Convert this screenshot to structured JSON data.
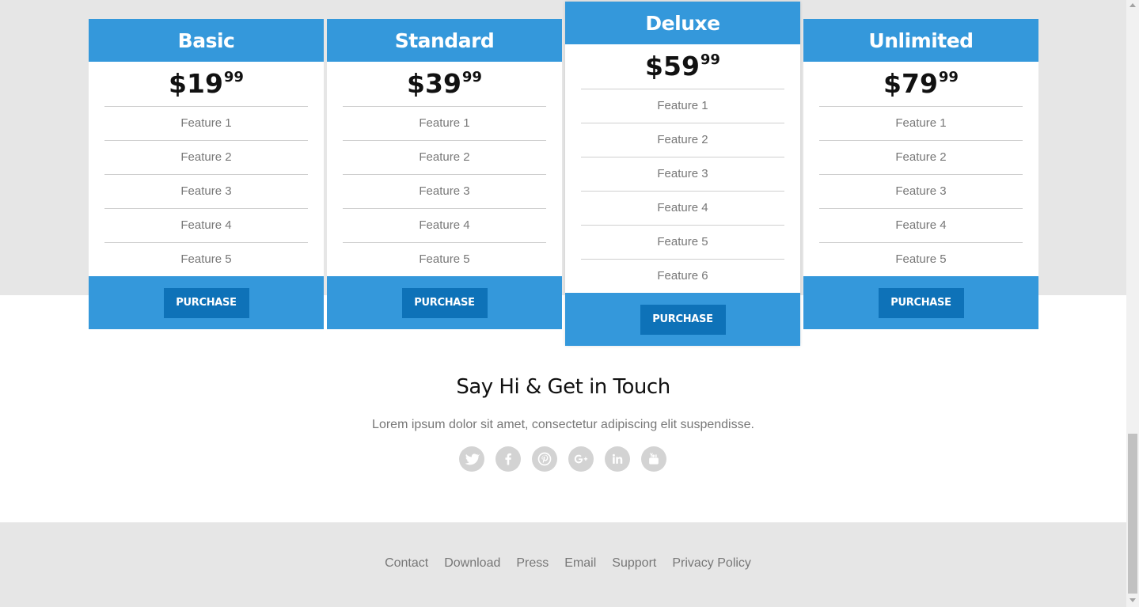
{
  "plans": [
    {
      "name": "Basic",
      "price_main": "$19",
      "price_cents": "99",
      "features": [
        "Feature 1",
        "Feature 2",
        "Feature 3",
        "Feature 4",
        "Feature 5"
      ],
      "button": "PURCHASE"
    },
    {
      "name": "Standard",
      "price_main": "$39",
      "price_cents": "99",
      "features": [
        "Feature 1",
        "Feature 2",
        "Feature 3",
        "Feature 4",
        "Feature 5"
      ],
      "button": "PURCHASE"
    },
    {
      "name": "Deluxe",
      "price_main": "$59",
      "price_cents": "99",
      "features": [
        "Feature 1",
        "Feature 2",
        "Feature 3",
        "Feature 4",
        "Feature 5",
        "Feature 6"
      ],
      "button": "PURCHASE"
    },
    {
      "name": "Unlimited",
      "price_main": "$79",
      "price_cents": "99",
      "features": [
        "Feature 1",
        "Feature 2",
        "Feature 3",
        "Feature 4",
        "Feature 5"
      ],
      "button": "PURCHASE"
    }
  ],
  "contact": {
    "title": "Say Hi & Get in Touch",
    "text": "Lorem ipsum dolor sit amet, consectetur adipiscing elit suspendisse.",
    "socials": [
      "twitter-icon",
      "facebook-icon",
      "pinterest-icon",
      "google-plus-icon",
      "linkedin-icon",
      "youtube-icon"
    ]
  },
  "footer": {
    "links": [
      "Contact",
      "Download",
      "Press",
      "Email",
      "Support",
      "Privacy Policy"
    ]
  },
  "colors": {
    "accent": "#3498db",
    "button": "#0e72b8",
    "background": "#e6e6e6"
  }
}
